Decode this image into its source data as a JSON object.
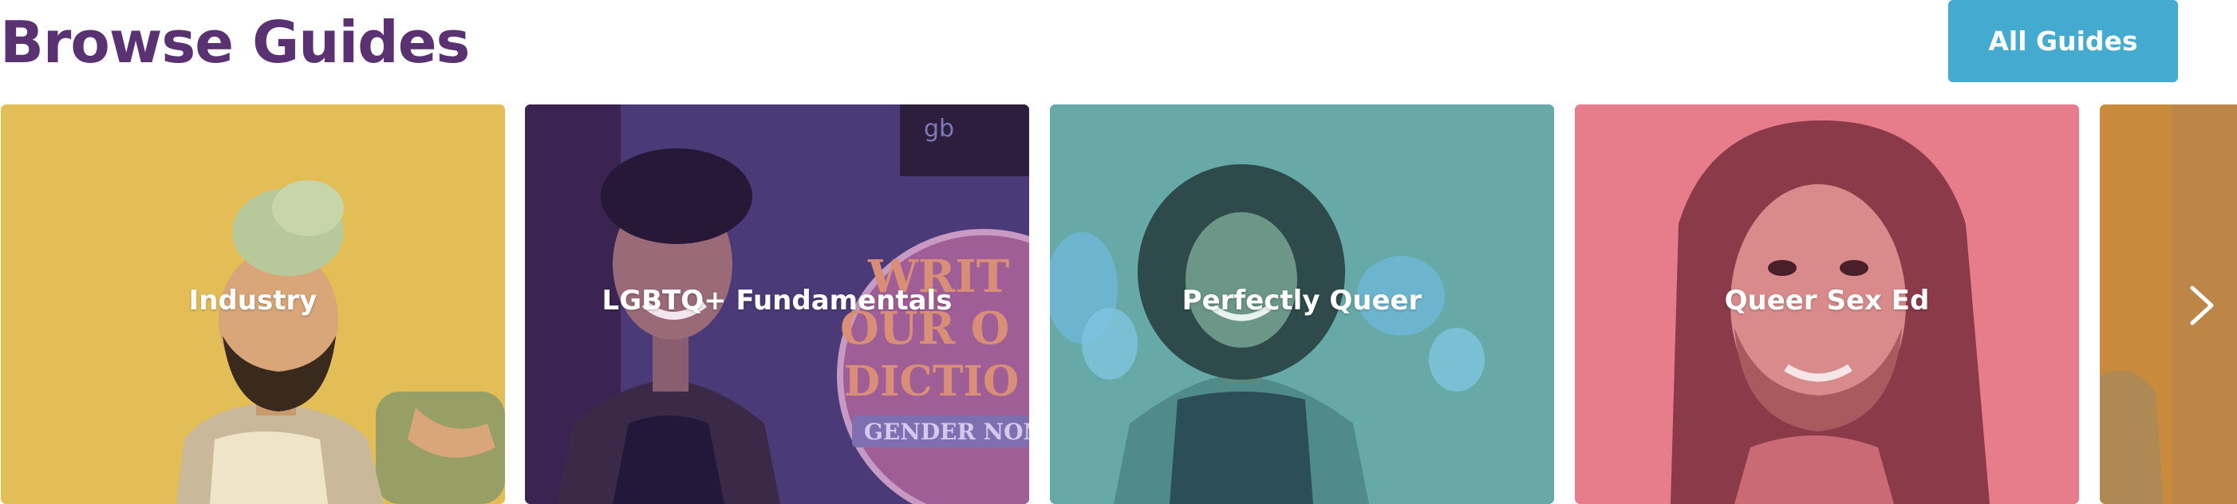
{
  "header": {
    "title": "Browse Guides",
    "all_guides_label": "All Guides"
  },
  "colors": {
    "title": "#5a3272",
    "button": "#45aacf",
    "card_yellow": "#e3bd55",
    "card_purple": "#4a2e62",
    "card_teal": "#66a9a6",
    "card_pink": "#e77c8b",
    "card_orange": "#c98a3c"
  },
  "cards": [
    {
      "label": "Industry",
      "color": "#e3bd55"
    },
    {
      "label": "LGBTQ+ Fundamentals",
      "color": "#4a2e62"
    },
    {
      "label": "Perfectly Queer",
      "color": "#66a9a6"
    },
    {
      "label": "Queer Sex Ed",
      "color": "#e77c8b"
    },
    {
      "label": "",
      "color": "#c98a3c"
    }
  ],
  "card_art": {
    "sign_lines": [
      "WRIT",
      "OUR O",
      "DICTIO"
    ],
    "sign_banner": "GENDER NON",
    "board_text": "gb"
  },
  "carousel": {
    "next_icon": "chevron-right-icon"
  }
}
